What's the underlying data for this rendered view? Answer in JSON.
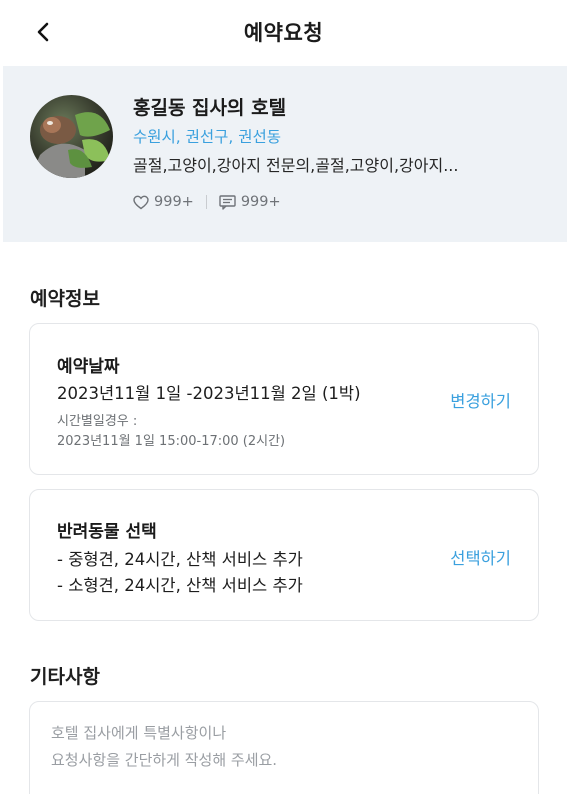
{
  "header": {
    "title": "예약요청",
    "back_icon": "chevron-left-icon"
  },
  "hotel": {
    "name": "홍길동 집사의 호텔",
    "location": "수원시, 권선구, 권선동",
    "tags": "골절,고양이,강아지 전문의,골절,고양이,강아지...",
    "likes": "999+",
    "comments": "999+",
    "accent_color": "#3aa0de"
  },
  "reservation": {
    "section_title": "예약정보",
    "date_card": {
      "title": "예약날짜",
      "range": "2023년11월 1일 -2023년11월 2일 (1박)",
      "hourly_label": "시간별일경우 :",
      "hourly_value": "2023년11월 1일 15:00-17:00 (2시간)",
      "action": "변경하기"
    },
    "pet_card": {
      "title": "반려동물 선택",
      "items": [
        "- 중형견, 24시간, 산책 서비스 추가",
        "- 소형견, 24시간, 산책 서비스 추가"
      ],
      "action": "선택하기"
    }
  },
  "other": {
    "section_title": "기타사항",
    "placeholder": "호텔 집사에게 특별사항이나\n요청사항을 간단하게 작성해 주세요."
  }
}
